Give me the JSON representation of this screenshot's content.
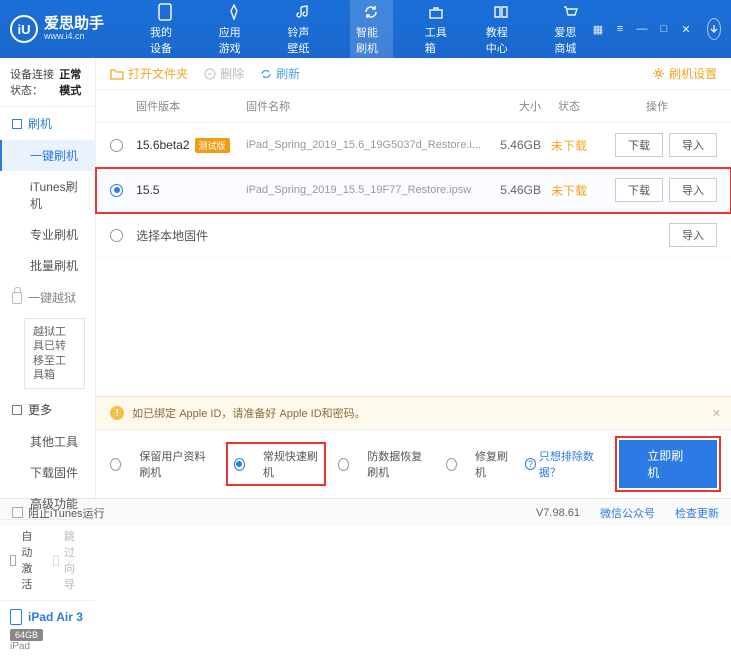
{
  "app": {
    "name": "爱思助手",
    "url": "www.i4.cn"
  },
  "nav": [
    {
      "label": "我的设备"
    },
    {
      "label": "应用游戏"
    },
    {
      "label": "铃声壁纸"
    },
    {
      "label": "智能刷机"
    },
    {
      "label": "工具箱"
    },
    {
      "label": "教程中心"
    },
    {
      "label": "爱思商城"
    }
  ],
  "side": {
    "status_label": "设备连接状态：",
    "status_value": "正常模式",
    "g1": "刷机",
    "subs1": [
      "一键刷机",
      "iTunes刷机",
      "专业刷机",
      "批量刷机"
    ],
    "g2": "一键越狱",
    "jail_notice": "越狱工具已转移至工具箱",
    "g3": "更多",
    "subs3": [
      "其他工具",
      "下载固件",
      "高级功能"
    ],
    "auto_activate": "自动激活",
    "skip_guide": "跳过向导",
    "device_name": "iPad Air 3",
    "device_cap": "64GB",
    "device_type": "iPad"
  },
  "tool": {
    "open": "打开文件夹",
    "del": "删除",
    "refresh": "刷新",
    "settings": "刷机设置"
  },
  "th": {
    "ver": "固件版本",
    "name": "固件名称",
    "size": "大小",
    "stat": "状态",
    "op": "操作"
  },
  "rows": [
    {
      "ver": "15.6beta2",
      "badge": "测试版",
      "name": "iPad_Spring_2019_15.6_19G5037d_Restore.i...",
      "size": "5.46GB",
      "stat": "未下载"
    },
    {
      "ver": "15.5",
      "badge": "",
      "name": "iPad_Spring_2019_15.5_19F77_Restore.ipsw",
      "size": "5.46GB",
      "stat": "未下载"
    }
  ],
  "local_row": "选择本地固件",
  "btn": {
    "download": "下载",
    "import": "导入"
  },
  "notice": "如已绑定 Apple ID，请准备好 Apple ID和密码。",
  "modes": {
    "keep": "保留用户资料刷机",
    "normal": "常规快速刷机",
    "antir": "防数据恢复刷机",
    "repair": "修复刷机",
    "exclude": "只想排除数据？",
    "go": "立即刷机"
  },
  "status": {
    "block": "阻止iTunes运行",
    "ver": "V7.98.61",
    "wx": "微信公众号",
    "upd": "检查更新"
  }
}
